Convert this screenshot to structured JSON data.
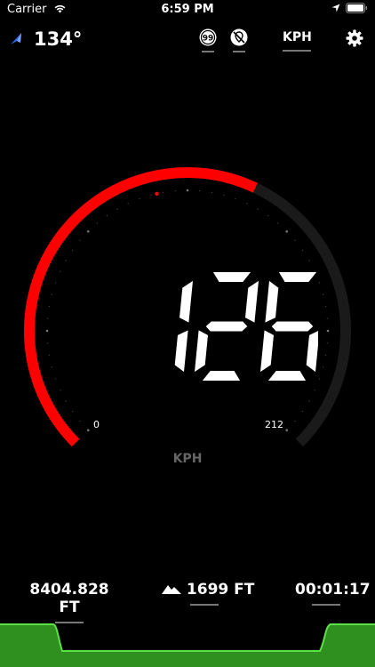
{
  "status_bar": {
    "carrier": "Carrier",
    "time": "6:59 PM"
  },
  "heading": {
    "value": "134°",
    "icon": "navigation-arrow-icon"
  },
  "header_icons": {
    "speed_limit": "99",
    "no_location_icon": "location-off-icon"
  },
  "unit_toggle": "KPH",
  "gauge": {
    "speed": "126",
    "min_label": "0",
    "max_label": "212",
    "unit": "KPH",
    "fill_fraction": 0.594,
    "fill_color": "#ff0000",
    "track_color": "#1a1a1a"
  },
  "stats": {
    "distance": "8404.828 FT",
    "altitude": "1699 FT",
    "elapsed": "00:01:17"
  },
  "graph_color": "#2f8f1f"
}
